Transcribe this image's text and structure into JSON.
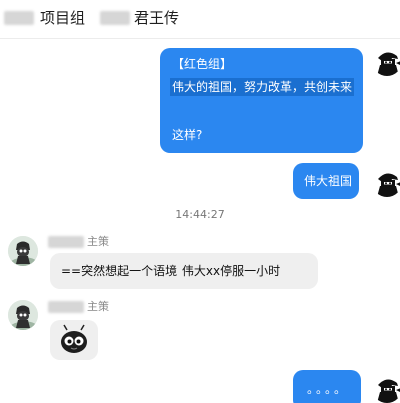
{
  "header": {
    "title_part1": "项目组",
    "title_part2": "君王传"
  },
  "messages": {
    "m1": {
      "line1": "【红色组】",
      "line2": "伟大的祖国，努力改革，共创未来",
      "line3": "这样?"
    },
    "m2": {
      "text": "伟大祖国"
    },
    "time": "14:44:27",
    "m3": {
      "sender_role": "主策",
      "text": "==突然想起一个语境   伟大xx停服一小时"
    },
    "m4": {
      "sender_role": "主策"
    },
    "m5": {
      "text": "。。。。"
    }
  },
  "colors": {
    "me_bubble": "#2b87f0",
    "other_bubble": "#efefef"
  },
  "icons": {
    "me_avatar": "ninja-avatar-icon",
    "other_avatar": "character-avatar-icon",
    "sticker": "bug-eyed-sticker-icon"
  }
}
